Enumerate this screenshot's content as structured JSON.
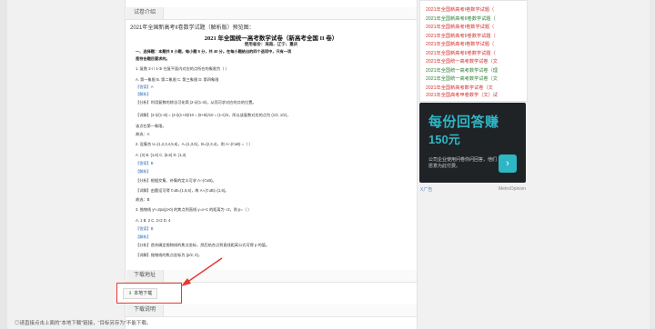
{
  "section_intro": "试卷介绍",
  "doc_title": "2021年全国新高考II卷数学试题（解析版）预览图：",
  "doc_heading": "2021 年全国统一高考数学试卷（新高考全国 II 卷）",
  "doc_sub": "使用省份：海南、辽宁、重庆",
  "doc_lines": [
    "一、选择题：本题共 8 小题，每小题 5 分，共 40 分。在每小题给出的四个选项中，只有一项",
    "是符合题目要求的。",
    "1. 复数 2-i / 1-3i 在复平面内对应的点所在的象限为（   ）",
    "A. 第一象限        B. 第二象限        C. 第三象限        D. 第四象限",
    "【答案】A",
    "【解析】",
    "【分析】利用复数的除法可化简 (2-i)/(1-3i)，从而可求对应的点的位置。",
    "【详解】(2-i)/(1-3i) = (2-i)(1+3i)/10 = (5+5i)/10 = (1+i)/2，所以该复数对应的点为 (1/2, 1/2)，",
    "该点在第一象限。",
    "故选：A",
    "2. 设集合 U={1,2,3,4,5,6}，A={1,3,6}，B={2,3,4}，则 A∩(∁uB) =（   ）",
    "A. {3}               B. {1,6}               C. {5,6}               D. {1,3}",
    "【答案】B",
    "【解析】",
    "【分析】根据交集、补集的定义可求 A∩(∁uB)。",
    "【详解】由题设可得 ∁uB={1,5,6}，故 A∩(∁uB)={1,6}。",
    "故选：B",
    "3. 抛物线 y²=2px(p>0) 的焦点到直线 y=x+1 的距离为 √2，则 p=（   ）",
    "A. 1                  B. 2                  C. 2√2                  D. 4",
    "【答案】B",
    "【解析】",
    "【分析】首先确定抛物线的焦点坐标，然后结合点到直线距离公式可得 p 的值。",
    "【详解】抛物线的焦点坐标为 (p/2, 0)，"
  ],
  "section_download": "下载地址",
  "download_label": "本地下载",
  "section_desc": "下载说明",
  "desc_text": "◎请直接点击上面的“本地下载”链接，“目标另存为”不能下载。",
  "sidebar_links": [
    {
      "text": "2021年全国新高考I卷数学试题（",
      "color": "red"
    },
    {
      "text": "2021年全国新高考II卷数学试题（",
      "color": "green"
    },
    {
      "text": "2021年全国新高考I卷数学试题（",
      "color": "red"
    },
    {
      "text": "2021年全国新高考II卷数学试题（",
      "color": "red"
    },
    {
      "text": "2021年全国新高考I卷数学试题（",
      "color": "red"
    },
    {
      "text": "2021年全国新高考II卷数学试题（",
      "color": "red"
    },
    {
      "text": "2021年全国统一高考数学试卷（文",
      "color": "red"
    },
    {
      "text": "2021年全国统一高考数学试卷（理",
      "color": "green"
    },
    {
      "text": "2021年全国统一高考数学试卷（文",
      "color": "green"
    },
    {
      "text": "2021年全国新高考数学试卷（文",
      "color": "red"
    },
    {
      "text": "2021年全国高考甲卷数学（文）试",
      "color": "red"
    }
  ],
  "ad": {
    "title": "每份回答赚",
    "amount": "150元",
    "desc": "公司企业使用问卷你问回答，他们愿意为此付费。",
    "button_icon": "chevron-right-icon",
    "foot_left": "X广告",
    "foot_right": "MetroOpinion"
  }
}
